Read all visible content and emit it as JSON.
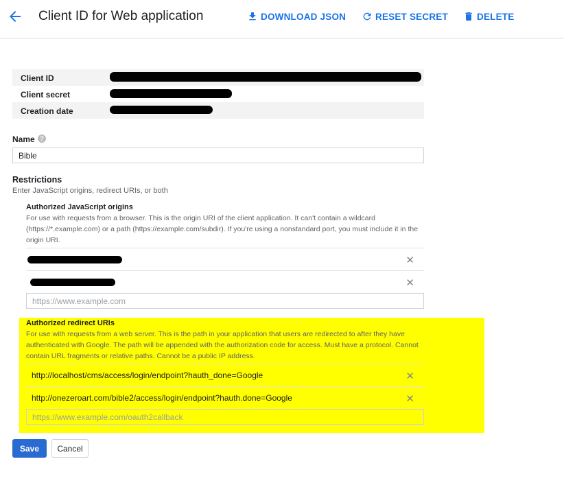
{
  "header": {
    "title": "Client ID for Web application",
    "download_label": "DOWNLOAD JSON",
    "reset_label": "RESET SECRET",
    "delete_label": "DELETE"
  },
  "client_info": {
    "rows": [
      {
        "label": "Client ID"
      },
      {
        "label": "Client secret"
      },
      {
        "label": "Creation date"
      }
    ]
  },
  "name_field": {
    "label": "Name",
    "help_glyph": "?",
    "value": "Bible"
  },
  "restrictions": {
    "title": "Restrictions",
    "subtitle": "Enter JavaScript origins, redirect URIs, or both"
  },
  "js_origins": {
    "title": "Authorized JavaScript origins",
    "description": "For use with requests from a browser. This is the origin URI of the client application. It can't contain a wildcard (https://*.example.com) or a path (https://example.com/subdir). If you're using a nonstandard port, you must include it in the origin URI.",
    "new_placeholder": "https://www.example.com"
  },
  "redirect_uris": {
    "title": "Authorized redirect URIs",
    "description": "For use with requests from a web server. This is the path in your application that users are redirected to after they have authenticated with Google. The path will be appended with the authorization code for access. Must have a protocol. Cannot contain URL fragments or relative paths. Cannot be a public IP address.",
    "items": [
      "http://localhost/cms/access/login/endpoint?hauth_done=Google",
      "http://onezeroart.com/bible2/access/login/endpoint?hauth.done=Google"
    ],
    "new_placeholder": "https://www.example.com/oauth2callback"
  },
  "remove_glyph": "✕",
  "buttons": {
    "save": "Save",
    "cancel": "Cancel"
  },
  "colors": {
    "accent": "#1a73e8",
    "save_bg": "#2a6bd1",
    "highlight": "#ffff00"
  },
  "icons": [
    "back-arrow-icon",
    "download-icon",
    "refresh-icon",
    "trash-icon",
    "help-icon",
    "close-icon"
  ]
}
